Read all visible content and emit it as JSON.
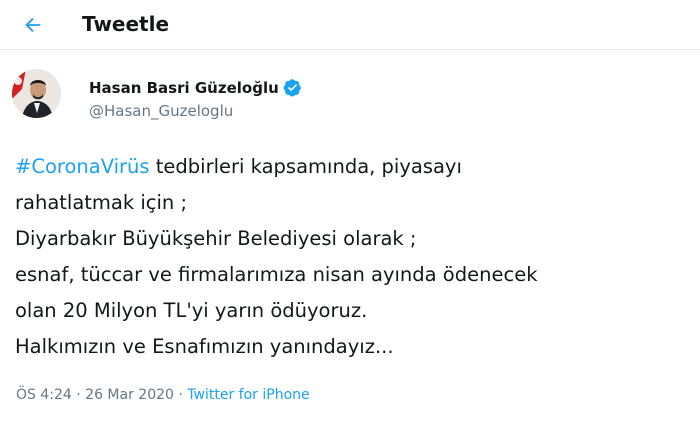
{
  "header": {
    "title": "Tweetle"
  },
  "author": {
    "name": "Hasan Basri Güzeloğlu",
    "handle": "@Hasan_Guzeloglu",
    "verified": true
  },
  "tweet": {
    "hashtag": "#CoronaVirüs",
    "lines": [
      " tedbirleri kapsamında, piyasayı",
      "rahatlatmak için ;",
      "Diyarbakır Büyükşehir Belediyesi olarak ;",
      "esnaf, tüccar ve firmalarımıza nisan ayında ödenecek",
      "olan 20 Milyon TL'yi yarın ödüyoruz.",
      "Halkımızın ve Esnafımızın yanındayız..."
    ]
  },
  "meta": {
    "time_prefix": "ÖS ",
    "time": "4:24",
    "separator1": " · ",
    "date": "26 Mar 2020",
    "separator2": " · ",
    "source": "Twitter for iPhone"
  },
  "colors": {
    "accent": "#1da1f2",
    "text": "#14171a",
    "secondary": "#657786"
  },
  "icons": {
    "back": "arrow-left-icon",
    "verified": "verified-badge-icon"
  }
}
